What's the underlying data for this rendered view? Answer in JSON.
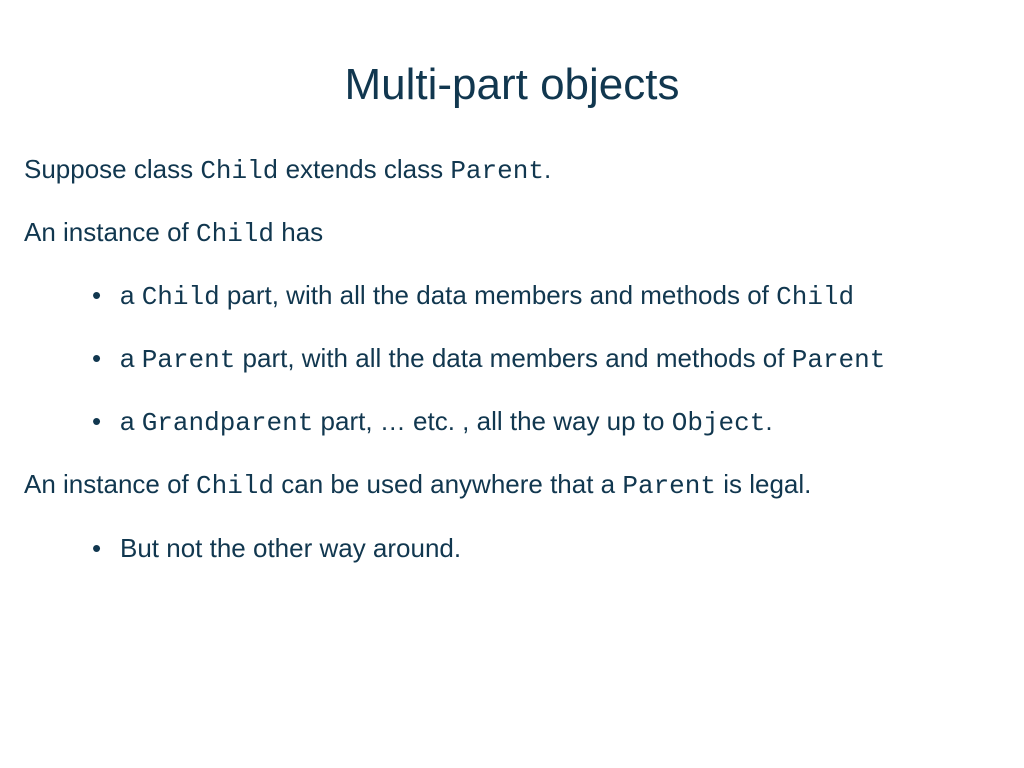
{
  "title": "Multi-part objects",
  "p1": {
    "t1": "Suppose class ",
    "c1": "Child",
    "t2": " extends class ",
    "c2": "Parent",
    "t3": "."
  },
  "p2": {
    "t1": "An instance of ",
    "c1": "Child",
    "t2": " has"
  },
  "b1": {
    "t1": "a ",
    "c1": "Child",
    "t2": " part, with all the data members and methods of ",
    "c2": "Child"
  },
  "b2": {
    "t1": "a ",
    "c1": "Parent",
    "t2": " part, with all the data members and methods of ",
    "c2": "Parent"
  },
  "b3": {
    "t1": "a ",
    "c1": "Grandparent",
    "t2": " part, … etc. , all the way up to ",
    "c2": "Object",
    "t3": "."
  },
  "p3": {
    "t1": "An instance of ",
    "c1": "Child",
    "t2": " can be used anywhere that a ",
    "c2": "Parent",
    "t3": " is legal."
  },
  "b4": {
    "t1": "But not the other way around."
  }
}
